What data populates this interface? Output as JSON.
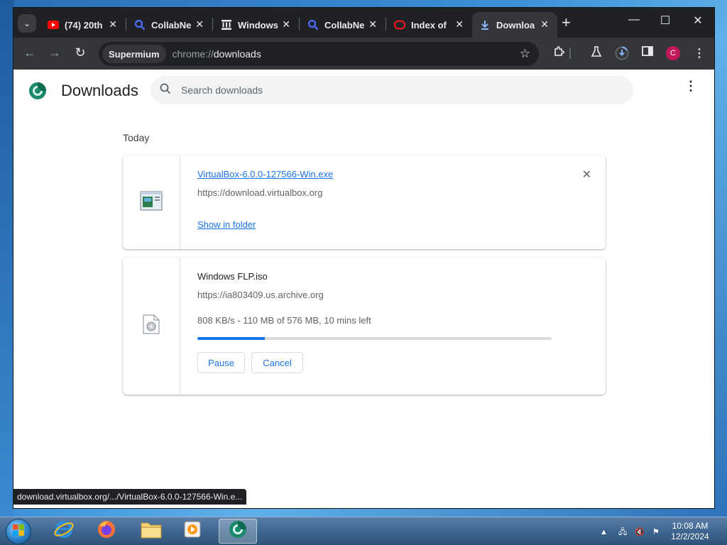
{
  "tabs": [
    {
      "title": "(74) 20th",
      "icon": "youtube-icon"
    },
    {
      "title": "CollabNe",
      "icon": "search-icon"
    },
    {
      "title": "Windows",
      "icon": "archive-icon"
    },
    {
      "title": "CollabNe",
      "icon": "search-icon"
    },
    {
      "title": "Index of",
      "icon": "oracle-icon"
    },
    {
      "title": "Downloa",
      "icon": "download-icon",
      "active": true
    }
  ],
  "toolbar": {
    "chip": "Supermium",
    "url_scheme": "chrome://",
    "url_path": "downloads",
    "avatar_letter": "C"
  },
  "page": {
    "title": "Downloads",
    "search_placeholder": "Search downloads",
    "section": "Today"
  },
  "downloads": [
    {
      "filename": "VirtualBox-6.0.0-127566-Win.exe",
      "source": "https://download.virtualbox.org",
      "action": "Show in folder",
      "icon": "exe-file-icon"
    },
    {
      "filename": "Windows FLP.iso",
      "source": "https://ia803409.us.archive.org",
      "status": "808 KB/s - 110 MB of 576 MB, 10 mins left",
      "progress_fraction": 0.19,
      "pause_label": "Pause",
      "cancel_label": "Cancel",
      "icon": "iso-file-icon"
    }
  ],
  "statusbar": "download.virtualbox.org/.../VirtualBox-6.0.0-127566-Win.e...",
  "taskbar": {
    "apps": [
      "internet-explorer-icon",
      "firefox-icon",
      "file-explorer-icon",
      "media-player-icon",
      "supermium-icon"
    ],
    "time": "10:08 AM",
    "date": "12/2/2024"
  },
  "colors": {
    "accent": "#1a73e8",
    "tab_bg": "#202124",
    "toolbar_bg": "#35363a"
  }
}
